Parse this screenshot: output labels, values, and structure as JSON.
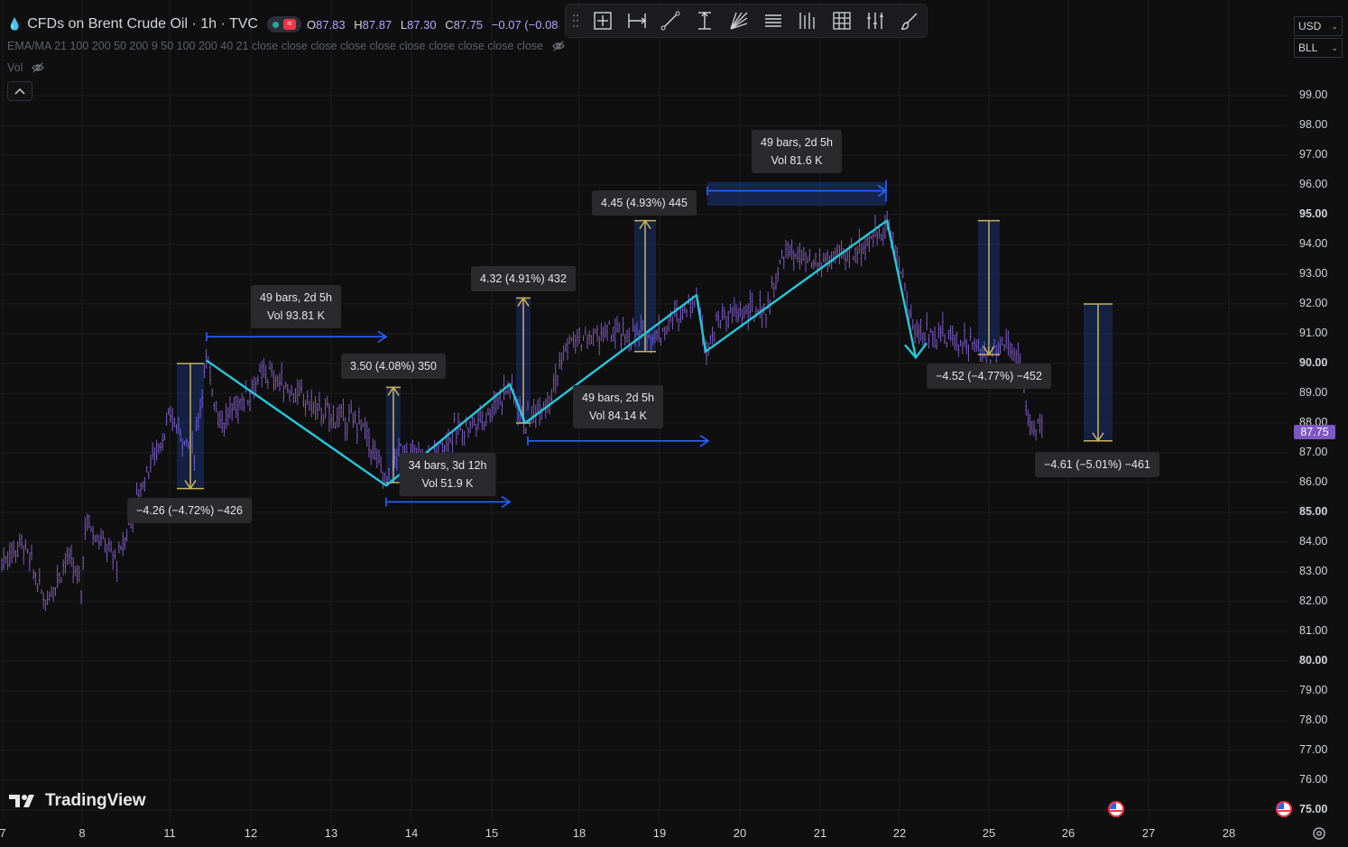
{
  "symbol": {
    "title": "CFDs on Brent Crude Oil · 1h · TVC",
    "status_wave": "≈",
    "ohlc": {
      "o_label": "O",
      "o_value": "87.83",
      "h_label": "H",
      "h_value": "87.87",
      "l_label": "L",
      "l_value": "87.30",
      "c_label": "C",
      "c_value": "87.75",
      "change": "−0.07 (−0.08"
    }
  },
  "indicators": {
    "ema_label": "EMA/MA 21 100 200 50 200 9 50 100 200 40 21 close close close close close close close close close close",
    "vol_label": "Vol"
  },
  "toolbar": {
    "buttons": [
      "date-price-range-tool",
      "date-range-tool",
      "trend-line-tool",
      "price-range-tool",
      "fib-fan-tool",
      "horizontal-lines-tool",
      "vertical-lines-tool",
      "grid-tool",
      "pitchfork-tool",
      "brush-tool"
    ]
  },
  "selectors": {
    "currency": "USD",
    "unit": "BLL"
  },
  "price_axis": {
    "labels": [
      "99.00",
      "98.00",
      "97.00",
      "96.00",
      "95.00",
      "94.00",
      "93.00",
      "92.00",
      "91.00",
      "90.00",
      "89.00",
      "88.00",
      "87.00",
      "86.00",
      "85.00",
      "84.00",
      "83.00",
      "82.00",
      "81.00",
      "80.00",
      "79.00",
      "78.00",
      "77.00",
      "76.00",
      "75.00"
    ],
    "major": [
      "95.00",
      "90.00",
      "85.00",
      "80.00",
      "75.00"
    ],
    "last_price": "87.75"
  },
  "time_axis": {
    "labels": [
      "7",
      "8",
      "11",
      "12",
      "13",
      "14",
      "15",
      "18",
      "19",
      "20",
      "21",
      "22",
      "25",
      "26",
      "27",
      "28"
    ]
  },
  "annotations": [
    {
      "id": "range-1",
      "lines": [
        "49 bars, 2d 5h",
        "Vol 93.81 K"
      ]
    },
    {
      "id": "change-1",
      "lines": [
        "−4.26 (−4.72%) −426"
      ]
    },
    {
      "id": "change-2",
      "lines": [
        "3.50 (4.08%) 350"
      ]
    },
    {
      "id": "range-2",
      "lines": [
        "34 bars, 3d 12h",
        "Vol 51.9 K"
      ]
    },
    {
      "id": "change-3",
      "lines": [
        "4.32 (4.91%) 432"
      ]
    },
    {
      "id": "range-3",
      "lines": [
        "49 bars, 2d 5h",
        "Vol 84.14 K"
      ]
    },
    {
      "id": "change-4",
      "lines": [
        "4.45 (4.93%) 445"
      ]
    },
    {
      "id": "range-4",
      "lines": [
        "49 bars, 2d 5h",
        "Vol 81.6 K"
      ]
    },
    {
      "id": "change-5",
      "lines": [
        "−4.52 (−4.77%) −452"
      ]
    },
    {
      "id": "change-6",
      "lines": [
        "−4.61 (−5.01%) −461"
      ]
    }
  ],
  "branding": {
    "logo_text": "TradingView"
  },
  "colors": {
    "background": "#0f0f0f",
    "candles": "#7e57c2",
    "zigzag": "#26c6da",
    "range_arrow": "#2962ff",
    "change_arrow": "#c9b35a",
    "price_tag": "#7e57c2"
  },
  "chart_data": {
    "type": "line",
    "title": "CFDs on Brent Crude Oil · 1h · TVC",
    "ylim": [
      75,
      99
    ],
    "x_ticks": [
      "7",
      "8",
      "11",
      "12",
      "13",
      "14",
      "15",
      "18",
      "19",
      "20",
      "21",
      "22",
      "25",
      "26",
      "27",
      "28"
    ],
    "zigzag_pivots": [
      {
        "date": "11",
        "price": 90.1
      },
      {
        "date": "13",
        "price": 85.9
      },
      {
        "date": "15",
        "price": 89.3
      },
      {
        "date": "15",
        "price": 88.0
      },
      {
        "date": "19",
        "price": 92.3
      },
      {
        "date": "19",
        "price": 90.4
      },
      {
        "date": "21",
        "price": 94.8
      },
      {
        "date": "22",
        "price": 90.2
      }
    ],
    "last_price": 87.75
  }
}
